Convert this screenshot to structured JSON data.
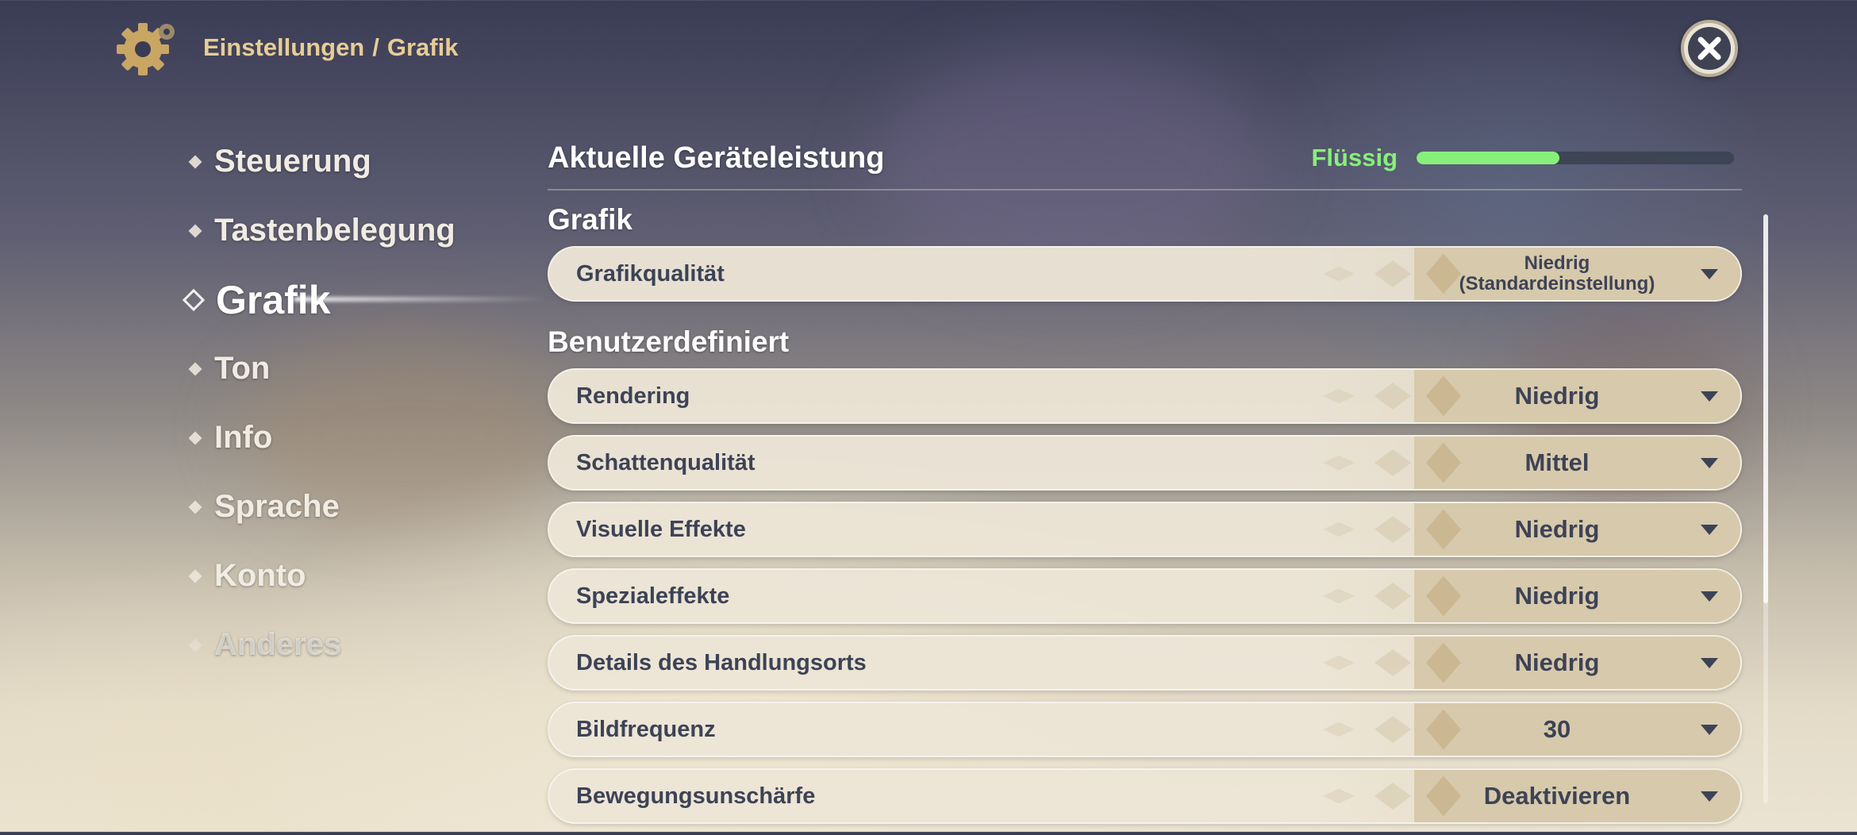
{
  "header": {
    "breadcrumb_root": "Einstellungen",
    "breadcrumb_sep": "/",
    "breadcrumb_current": "Grafik",
    "icon": "gear-icon",
    "close_icon": "close-icon"
  },
  "sidebar": {
    "items": [
      {
        "label": "Steuerung",
        "active": false
      },
      {
        "label": "Tastenbelegung",
        "active": false
      },
      {
        "label": "Grafik",
        "active": true
      },
      {
        "label": "Ton",
        "active": false
      },
      {
        "label": "Info",
        "active": false
      },
      {
        "label": "Sprache",
        "active": false
      },
      {
        "label": "Konto",
        "active": false
      },
      {
        "label": "Anderes",
        "active": false
      }
    ]
  },
  "performance": {
    "title": "Aktuelle Geräteleistung",
    "status": "Flüssig",
    "level_fraction": 0.45,
    "color": "#87f07a"
  },
  "sections": {
    "grafik": {
      "title": "Grafik",
      "quality_label": "Grafikqualität",
      "quality_value_line1": "Niedrig",
      "quality_value_line2": "(Standardeinstellung)"
    },
    "custom": {
      "title": "Benutzerdefiniert",
      "rows": [
        {
          "label": "Rendering",
          "value": "Niedrig"
        },
        {
          "label": "Schattenqualität",
          "value": "Mittel"
        },
        {
          "label": "Visuelle Effekte",
          "value": "Niedrig"
        },
        {
          "label": "Spezialeffekte",
          "value": "Niedrig"
        },
        {
          "label": "Details des Handlungsorts",
          "value": "Niedrig"
        },
        {
          "label": "Bildfrequenz",
          "value": "30"
        },
        {
          "label": "Bewegungsunschärfe",
          "value": "Deaktivieren"
        }
      ]
    }
  },
  "colors": {
    "accent_gold": "#e7cd95",
    "text_dark": "#3d4356",
    "row_bg": "#ece5d6"
  }
}
